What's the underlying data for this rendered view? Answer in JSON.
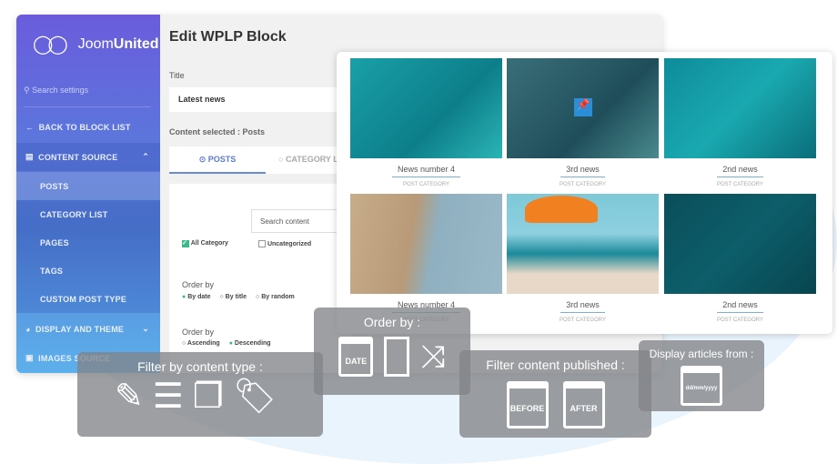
{
  "brand": {
    "name_light": "Joom",
    "name_bold": "United"
  },
  "page": {
    "title": "Edit WPLP Block",
    "title_label": "Title",
    "title_value": "Latest news",
    "content_selected": "Content selected : Posts"
  },
  "sidebar": {
    "search_placeholder": "Search settings",
    "back": "BACK TO BLOCK LIST",
    "sections": [
      {
        "label": "CONTENT SOURCE",
        "items": [
          "POSTS",
          "CATEGORY LIST",
          "PAGES",
          "TAGS",
          "CUSTOM POST TYPE"
        ]
      },
      {
        "label": "DISPLAY AND THEME"
      },
      {
        "label": "IMAGES SOURCE"
      }
    ]
  },
  "tabs": [
    "POSTS",
    "CATEGORY L"
  ],
  "filter": {
    "search_placeholder": "Search content",
    "categories": [
      {
        "label": "All Category",
        "checked": true
      },
      {
        "label": "Uncategorized",
        "checked": false
      }
    ],
    "order_label": "Order by",
    "order_options": [
      "By date",
      "By title",
      "By random"
    ],
    "order_selected": "By date",
    "dir_label": "Order by",
    "dir_options": [
      "Ascending",
      "Descending"
    ],
    "dir_selected": "Descending"
  },
  "preview": {
    "items": [
      {
        "title": "News number 4",
        "category": "POST CATEGORY"
      },
      {
        "title": "3rd news",
        "category": "POST CATEGORY"
      },
      {
        "title": "2nd news",
        "category": "POST CATEGORY"
      },
      {
        "title": "News number 4",
        "category": "POST CATEGORY"
      },
      {
        "title": "3rd news",
        "category": "POST CATEGORY"
      },
      {
        "title": "2nd news",
        "category": "POST CATEGORY"
      }
    ]
  },
  "overlays": {
    "content_type": "Filter by content type :",
    "order_by": "Order by :",
    "date_icon": "DATE",
    "published": "Filter content published :",
    "before": "BEFORE",
    "after": "AFTER",
    "display_from": "Display articles from :",
    "date_format": "dd/mm/yyyy"
  },
  "colors": {
    "sidebar_top": "#6a5cdc",
    "sidebar_bottom": "#5cb0ec",
    "accent": "#4a8fd6",
    "checkbox": "#3cb88a"
  }
}
